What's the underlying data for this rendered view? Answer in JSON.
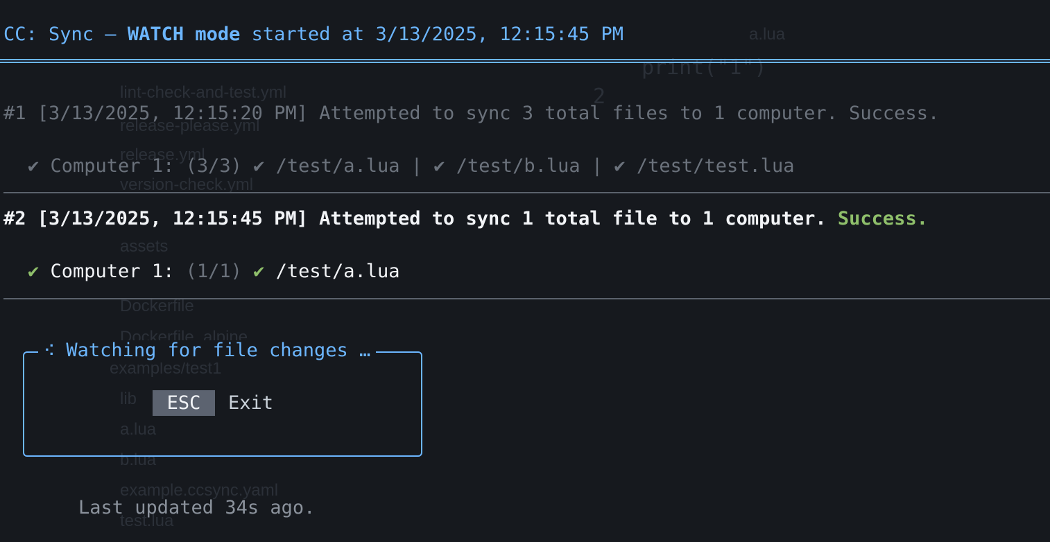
{
  "background": {
    "items": [
      "print(\"1\")",
      "2",
      "lint-check-and-test.yml",
      "release-please.yml",
      "release.yml",
      "version-check.yml",
      "assets",
      "Dockerfile",
      "Dockerfile_alpine",
      "examples/test1",
      "lib",
      "a.lua",
      "b.lua",
      "example.ccsync.yaml",
      "test.lua",
      "a.lua"
    ]
  },
  "header": {
    "prefix": "CC: Sync – ",
    "mode": "WATCH mode",
    "suffix": " started at 3/13/2025, 12:15:45 PM"
  },
  "syncs": [
    {
      "label": "#1 [3/13/2025, 12:15:20 PM] Attempted to sync 3 total files to 1 computer. ",
      "status": "Success.",
      "computer": {
        "check": "✔",
        "name": " Computer 1: ",
        "count": "(3/3)",
        "files": [
          {
            "check": "✔",
            "path": " /test/a.lua"
          },
          {
            "check": "✔",
            "path": " /test/b.lua"
          },
          {
            "check": "✔",
            "path": " /test/test.lua"
          }
        ],
        "separator": " | "
      }
    },
    {
      "label": "#2 [3/13/2025, 12:15:45 PM] Attempted to sync 1 total file to 1 computer. ",
      "status": "Success.",
      "computer": {
        "check": "✔",
        "name": " Computer 1: ",
        "count": "(1/1)",
        "files": [
          {
            "check": "✔",
            "path": " /test/a.lua"
          }
        ]
      }
    }
  ],
  "watch": {
    "spinner": "⠪",
    "title": " Watching for file changes …",
    "key": "ESC",
    "key_label": "Exit"
  },
  "footer": {
    "text": "Last updated 34s ago."
  },
  "colors": {
    "background": "#16191e",
    "accent_blue": "#6cb6ff",
    "success_green": "#8fbf6b",
    "muted_gray": "#8b929c",
    "key_bg": "#5c6370"
  }
}
